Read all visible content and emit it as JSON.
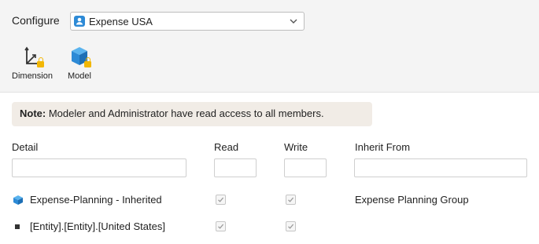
{
  "header": {
    "configure_label": "Configure",
    "selected_model": "Expense USA",
    "tools": [
      {
        "label": "Dimension",
        "icon": "dimension-axis-icon",
        "locked": true
      },
      {
        "label": "Model",
        "icon": "model-cube-icon",
        "locked": true
      }
    ]
  },
  "note": {
    "prefix": "Note:",
    "text": "Modeler and Administrator have read access to all members."
  },
  "table": {
    "columns": {
      "detail": "Detail",
      "read": "Read",
      "write": "Write",
      "inherit_from": "Inherit From"
    },
    "filters": {
      "detail": "",
      "read": "",
      "write": "",
      "inherit_from": ""
    },
    "rows": [
      {
        "icon": "model-cube-icon",
        "detail": "Expense-Planning - Inherited",
        "read": true,
        "write": true,
        "inherit_from": "Expense Planning Group"
      },
      {
        "icon": "bullet-icon",
        "detail": "[Entity].[Entity].[United States]",
        "read": true,
        "write": true,
        "inherit_from": ""
      }
    ]
  },
  "colors": {
    "accent_blue": "#2d8ad6",
    "lock_yellow": "#f2b705",
    "note_bg": "#f1ece6",
    "topbar_bg": "#f4f4f4"
  }
}
